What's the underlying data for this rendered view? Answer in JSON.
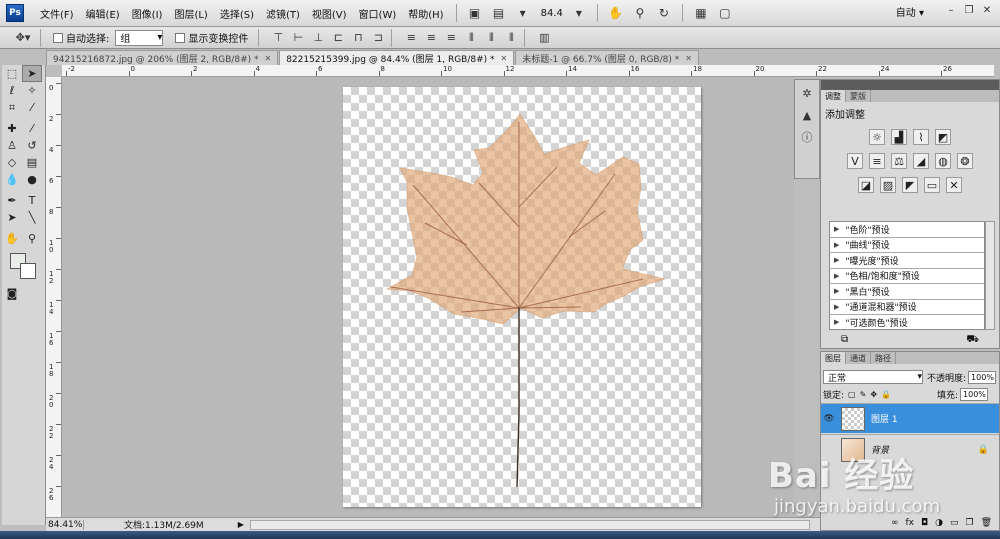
{
  "app": {
    "logo": "Ps"
  },
  "menu": [
    "文件(F)",
    "编辑(E)",
    "图像(I)",
    "图层(L)",
    "选择(S)",
    "滤镜(T)",
    "视图(V)",
    "窗口(W)",
    "帮助(H)"
  ],
  "menubar": {
    "zoom_value": "84.4",
    "workspace": "自动",
    "workspace_arrow": "▾"
  },
  "options": {
    "auto_select_label": "自动选择:",
    "auto_select_value": "组",
    "show_transform_label": "显示变换控件"
  },
  "tabs": [
    {
      "label": "94215216872.jpg @ 206% (图层 2, RGB/8#) *",
      "active": false
    },
    {
      "label": "82215215399.jpg @ 84.4% (图层 1, RGB/8#) *",
      "active": true
    },
    {
      "label": "未标题-1 @ 66.7% (图层 0, RGB/8) *",
      "active": false
    }
  ],
  "ruler": {
    "h_labels": [
      "-2",
      "0",
      "2",
      "4",
      "6",
      "8",
      "10",
      "12",
      "14",
      "16",
      "18",
      "20",
      "22",
      "24",
      "26"
    ],
    "v_labels": [
      "0",
      "2",
      "4",
      "6",
      "8",
      "1\n0",
      "1\n2",
      "1\n4",
      "1\n6",
      "1\n8",
      "2\n0",
      "2\n2",
      "2\n4",
      "2\n6"
    ]
  },
  "status": {
    "zoom": "84.41%",
    "doc": "文档:1.13M/2.69M",
    "arrow": "▶"
  },
  "adjustments": {
    "tabs": [
      "调整",
      "蒙版"
    ],
    "title": "添加调整",
    "presets": [
      "\"色阶\"预设",
      "\"曲线\"预设",
      "\"曝光度\"预设",
      "\"色相/饱和度\"预设",
      "\"黑白\"预设",
      "\"通道混和器\"预设",
      "\"可选颜色\"预设"
    ]
  },
  "layers": {
    "tabs": [
      "图层",
      "通道",
      "路径"
    ],
    "blend_mode": "正常",
    "opacity_label": "不透明度:",
    "opacity": "100%",
    "lock_label": "锁定:",
    "fill_label": "填充:",
    "fill": "100%",
    "items": [
      {
        "name": "图层 1",
        "selected": true
      },
      {
        "name": "背景",
        "selected": false
      }
    ]
  },
  "watermark": {
    "brand": "Bai 经验",
    "url": "jingyan.baidu.com"
  }
}
